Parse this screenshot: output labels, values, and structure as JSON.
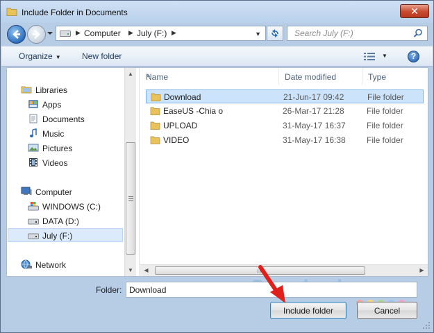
{
  "window": {
    "title": "Include Folder in Documents",
    "close_label": "✕"
  },
  "address_bar": {
    "crumbs": [
      "Computer",
      "July (F:)"
    ],
    "search_placeholder": "Search July (F:)"
  },
  "toolbar": {
    "organize_label": "Organize",
    "new_folder_label": "New folder",
    "help_label": "?"
  },
  "nav_pane": {
    "items": [
      {
        "label": "Libraries",
        "icon": "libraries-icon"
      },
      {
        "label": "Apps",
        "icon": "apps-icon"
      },
      {
        "label": "Documents",
        "icon": "documents-icon"
      },
      {
        "label": "Music",
        "icon": "music-icon"
      },
      {
        "label": "Pictures",
        "icon": "pictures-icon"
      },
      {
        "label": "Videos",
        "icon": "videos-icon"
      },
      {
        "label": "Computer",
        "icon": "computer-icon"
      },
      {
        "label": "WINDOWS (C:)",
        "icon": "windows-drive-icon"
      },
      {
        "label": "DATA (D:)",
        "icon": "drive-icon"
      },
      {
        "label": "July (F:)",
        "icon": "drive-icon",
        "selected": true
      },
      {
        "label": "Network",
        "icon": "network-icon"
      }
    ]
  },
  "file_list": {
    "columns": [
      "Name",
      "Date modified",
      "Type"
    ],
    "rows": [
      {
        "name": "Download",
        "date": "21-Jun-17 09:42",
        "type": "File folder",
        "selected": true
      },
      {
        "name": "EaseUS -Chia o",
        "date": "26-Mar-17 21:28",
        "type": "File folder"
      },
      {
        "name": "UPLOAD",
        "date": "31-May-17 16:37",
        "type": "File folder"
      },
      {
        "name": "VIDEO",
        "date": "31-May-17 16:38",
        "type": "File folder"
      }
    ]
  },
  "footer": {
    "folder_label": "Folder:",
    "folder_value": "Download",
    "include_button": "Include folder",
    "cancel_button": "Cancel"
  },
  "watermark": {
    "text": "Download.com.vn",
    "dot_colors": [
      "#f4a6a0",
      "#f7d27a",
      "#a9d88f",
      "#9cc7ef",
      "#f2a3c8"
    ]
  },
  "colors": {
    "selection": "#cce4fb",
    "accent_arrow": "#e0201b"
  }
}
